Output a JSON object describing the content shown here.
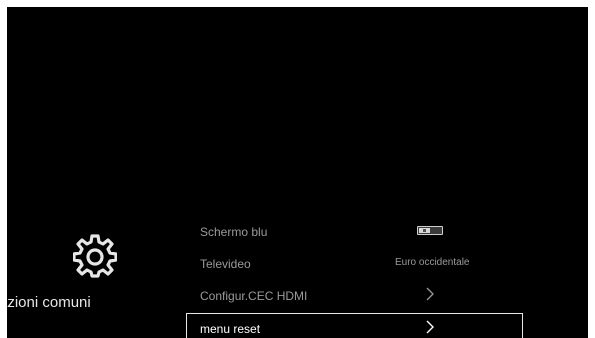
{
  "category": {
    "label": "azioni comuni",
    "icon": "gear-icon"
  },
  "menu": {
    "items": [
      {
        "label": "Schermo blu",
        "control": "toggle",
        "state": "off"
      },
      {
        "label": "Televideo",
        "value": "Euro occidentale"
      },
      {
        "label": "Configur.CEC HDMI",
        "control": "chevron"
      },
      {
        "label": "menu reset",
        "control": "chevron",
        "selected": true
      }
    ]
  },
  "colors": {
    "background": "#000000",
    "text_dim": "#9a9a9a",
    "text_selected": "#ffffff",
    "highlight_border": "#e8e8e8"
  }
}
